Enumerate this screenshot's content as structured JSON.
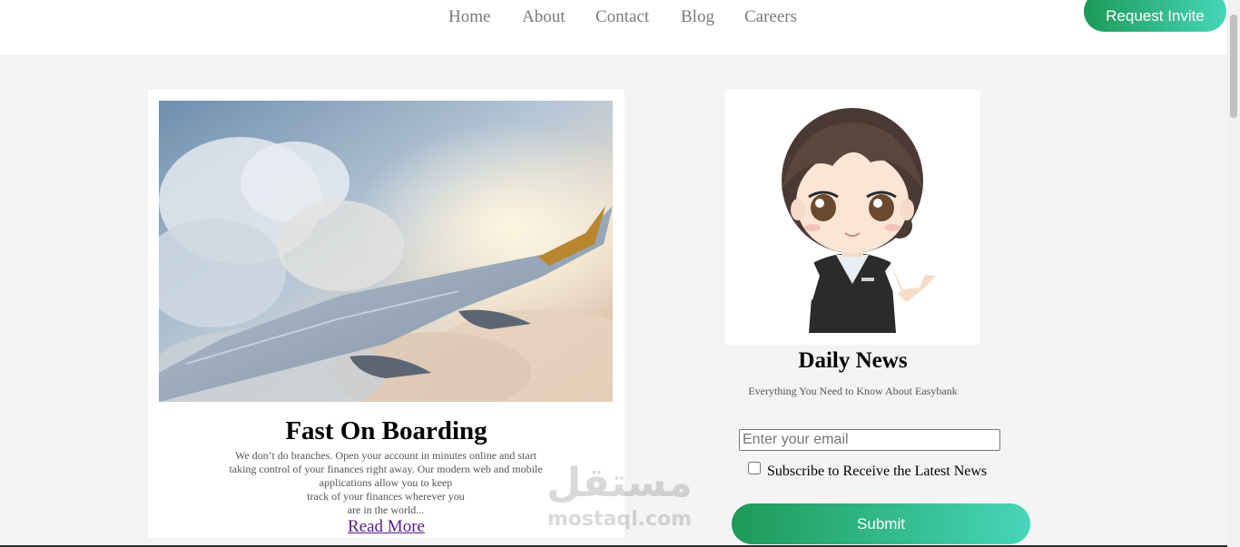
{
  "nav": {
    "items": [
      {
        "label": "Home"
      },
      {
        "label": "About"
      },
      {
        "label": "Contact"
      },
      {
        "label": "Blog"
      },
      {
        "label": "Careers"
      }
    ],
    "request_button": "Request Invite"
  },
  "card": {
    "title": "Fast On Boarding",
    "description_lines": [
      "We don’t do branches. Open your account in minutes online and start",
      "taking control of your finances right away. Our modern web and mobile",
      "applications allow you to keep",
      "track of your finances wherever you",
      "are in the world..."
    ],
    "read_more": "Read More"
  },
  "news": {
    "title": "Daily News",
    "subtitle": "Everything You Need to Know About Easybank",
    "email_placeholder": "Enter your email",
    "subscribe_label": "Subscribe to Receive the Latest News",
    "submit_label": "Submit"
  },
  "watermark": {
    "arabic": "مستقل",
    "latin": "mostaql.com"
  },
  "colors": {
    "button_gradient_start": "#1d9a57",
    "button_gradient_end": "#47d6ba",
    "page_background": "#f4f4f4",
    "nav_text": "#7a7a7a",
    "link_visited": "#551a8b"
  }
}
